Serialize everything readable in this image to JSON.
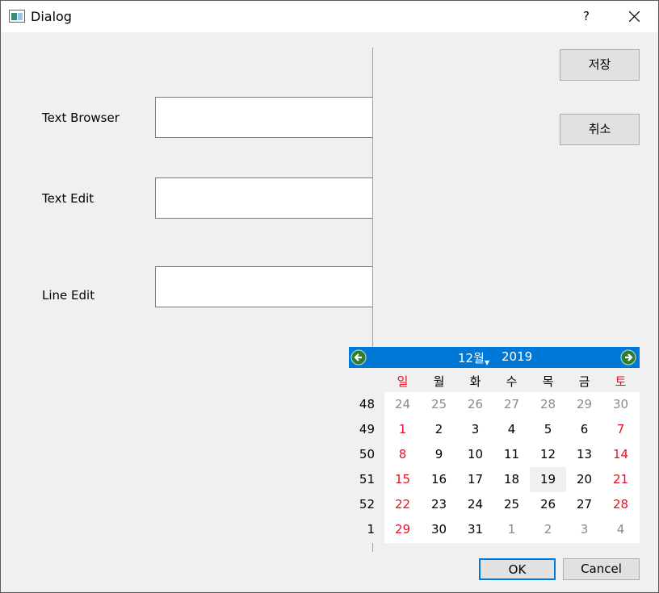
{
  "window": {
    "title": "Dialog",
    "help_label": "?"
  },
  "form": {
    "fields": [
      {
        "label": "Text Browser",
        "value": ""
      },
      {
        "label": "Text Edit",
        "value": ""
      },
      {
        "label": "Line Edit",
        "value": ""
      }
    ]
  },
  "side_buttons": {
    "save_label": "저장",
    "cancel_label": "취소"
  },
  "calendar": {
    "month_label": "12월",
    "year_label": "2019",
    "days_of_week": [
      "일",
      "월",
      "화",
      "수",
      "목",
      "금",
      "토"
    ],
    "week_numbers": [
      "48",
      "49",
      "50",
      "51",
      "52",
      "1"
    ],
    "weeks": [
      [
        "24",
        "25",
        "26",
        "27",
        "28",
        "29",
        "30"
      ],
      [
        "1",
        "2",
        "3",
        "4",
        "5",
        "6",
        "7"
      ],
      [
        "8",
        "9",
        "10",
        "11",
        "12",
        "13",
        "14"
      ],
      [
        "15",
        "16",
        "17",
        "18",
        "19",
        "20",
        "21"
      ],
      [
        "22",
        "23",
        "24",
        "25",
        "26",
        "27",
        "28"
      ],
      [
        "29",
        "30",
        "31",
        "1",
        "2",
        "3",
        "4"
      ]
    ],
    "selected_day": "19",
    "weekend_color": "#e81123",
    "header_color": "#0078d7"
  },
  "dialog_buttons": {
    "ok_label": "OK",
    "cancel_label": "Cancel"
  }
}
